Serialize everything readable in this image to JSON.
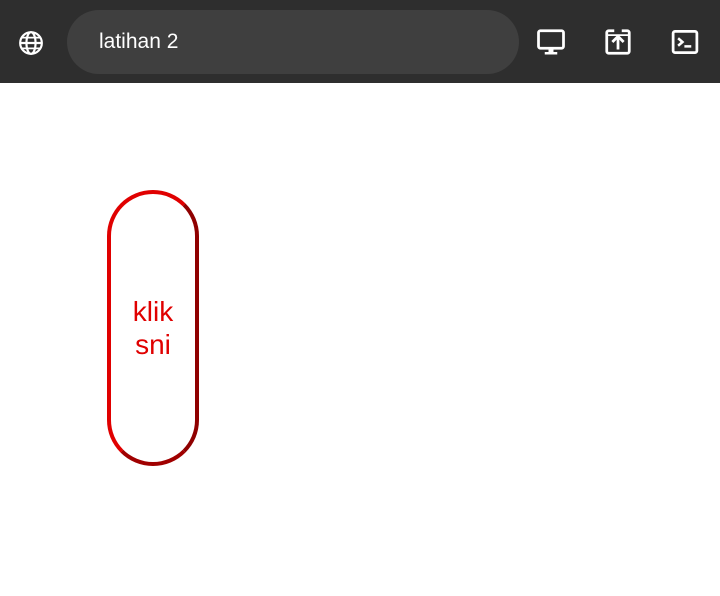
{
  "toolbar": {
    "address": "latihan 2",
    "icons": {
      "site": "globe-icon",
      "desktop": "desktop-icon",
      "open": "open-in-new-icon",
      "terminal": "terminal-icon"
    }
  },
  "main": {
    "button_label": "klik sni"
  },
  "colors": {
    "toolbar_bg": "#2e2e2e",
    "address_bg": "#3f3f3f",
    "accent": "#e00000"
  }
}
